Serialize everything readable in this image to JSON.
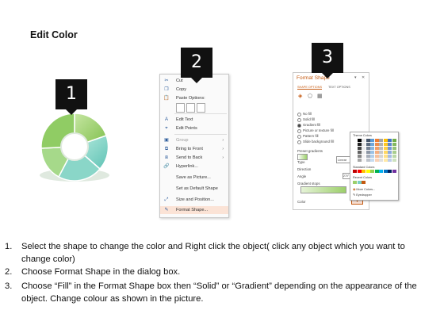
{
  "title": "Edit Color",
  "badges": [
    "1",
    "2",
    "3"
  ],
  "colors": {
    "badge": "#111111",
    "panel_accent": "#c55a11",
    "menu_highlight": "#fbe3d6",
    "wheel_green": "#9ccf6a",
    "wheel_teal": "#79cfc3"
  },
  "context_menu": {
    "items": [
      {
        "icon": "scissors-icon",
        "label": "Cut",
        "arrow": ""
      },
      {
        "icon": "copy-icon",
        "label": "Copy",
        "arrow": ""
      },
      {
        "icon": "paste-icon",
        "label": "Paste Options:",
        "arrow": ""
      },
      {
        "icon": "edit-text-icon",
        "label": "Edit Text",
        "arrow": ""
      },
      {
        "icon": "edit-points-icon",
        "label": "Edit Points",
        "arrow": ""
      },
      {
        "icon": "group-icon",
        "label": "Group",
        "arrow": "›"
      },
      {
        "icon": "bring-to-front-icon",
        "label": "Bring to Front",
        "arrow": "›"
      },
      {
        "icon": "send-to-back-icon",
        "label": "Send to Back",
        "arrow": "›"
      },
      {
        "icon": "hyperlink-icon",
        "label": "Hyperlink...",
        "arrow": ""
      },
      {
        "icon": "",
        "label": "Save as Picture...",
        "arrow": ""
      },
      {
        "icon": "",
        "label": "Set as Default Shape",
        "arrow": ""
      },
      {
        "icon": "size-position-icon",
        "label": "Size and Position...",
        "arrow": ""
      },
      {
        "icon": "format-shape-icon",
        "label": "Format Shape...",
        "arrow": ""
      }
    ]
  },
  "format_panel": {
    "title": "Format Shape",
    "tabs": [
      "SHAPE OPTIONS",
      "TEXT OPTIONS"
    ],
    "fill_options": [
      {
        "label": "No fill",
        "selected": false
      },
      {
        "label": "Solid fill",
        "selected": false
      },
      {
        "label": "Gradient fill",
        "selected": true
      },
      {
        "label": "Picture or texture fill",
        "selected": false
      },
      {
        "label": "Pattern fill",
        "selected": false
      },
      {
        "label": "Slide background fill",
        "selected": false
      }
    ],
    "fields": [
      "Preset gradients",
      "Type",
      "Direction",
      "Angle",
      "Gradient stops",
      "Color"
    ],
    "type_value": "Linear",
    "angle_value": "270°"
  },
  "palette": {
    "theme_label": "Theme Colors",
    "standard_label": "Standard Colors",
    "recent_label": "Recent Colors",
    "more_colors": "More Colors...",
    "eyedropper": "Eyedropper"
  },
  "steps": [
    {
      "num": "1.",
      "text": "Select the shape to change the color and Right click the object( click any object which you want to change color)"
    },
    {
      "num": "2.",
      "text": "Choose Format Shape in the dialog box."
    },
    {
      "num": "3.",
      "text": "Choose “Fill” in the Format Shape box then “Solid” or “Gradient” depending on the appearance of the object. Change colour as shown in the picture."
    }
  ]
}
